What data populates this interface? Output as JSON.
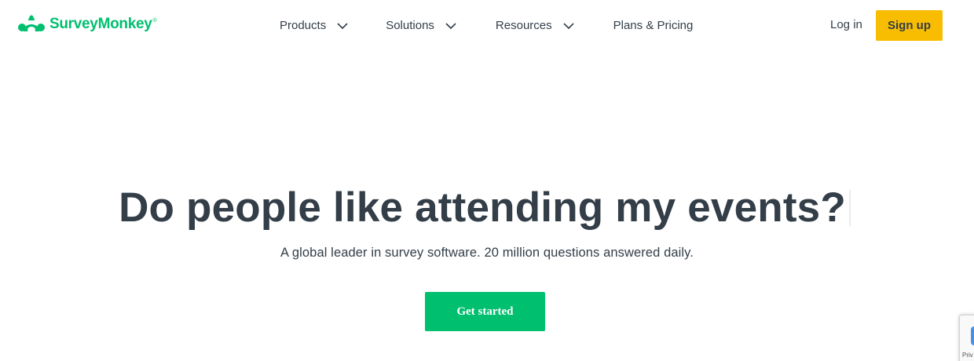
{
  "header": {
    "logo_text": "SurveyMonkey",
    "logo_mark": "®",
    "nav": {
      "products": "Products",
      "solutions": "Solutions",
      "resources": "Resources",
      "pricing": "Plans & Pricing"
    },
    "login_label": "Log in",
    "signup_label": "Sign up"
  },
  "hero": {
    "headline": "Do people like attending my events?",
    "subheadline": "A global leader in survey software. 20 million questions answered daily.",
    "cta_label": "Get started"
  },
  "recaptcha": {
    "text": "Priv"
  },
  "colors": {
    "brand_green": "#00bf6f",
    "signup_yellow": "#f8bd00",
    "text_dark": "#333e48"
  },
  "icons": {
    "logo": "surveymonkey-logo-icon",
    "dropdown": "chevron-down-icon",
    "recaptcha": "recaptcha-icon"
  }
}
